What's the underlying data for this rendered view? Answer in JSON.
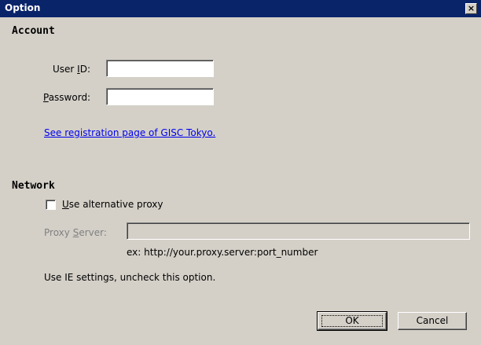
{
  "window": {
    "title": "Option",
    "close_label": "×"
  },
  "account": {
    "heading": "Account",
    "user_id_label_pre": "User ",
    "user_id_label_key": "I",
    "user_id_label_post": "D:",
    "user_id_value": "",
    "password_label_key": "P",
    "password_label_post": "assword:",
    "password_value": "",
    "registration_link": "See registration page of GISC Tokyo."
  },
  "network": {
    "heading": "Network",
    "checkbox_label_key": "U",
    "checkbox_label_post": "se alternative proxy",
    "checkbox_checked": false,
    "proxy_label_pre": "Proxy ",
    "proxy_label_key": "S",
    "proxy_label_post": "erver:",
    "proxy_value": "",
    "proxy_example": "ex: http://your.proxy.server:port_number",
    "ie_note": "Use IE settings, uncheck this option."
  },
  "buttons": {
    "ok": "OK",
    "cancel": "Cancel"
  }
}
